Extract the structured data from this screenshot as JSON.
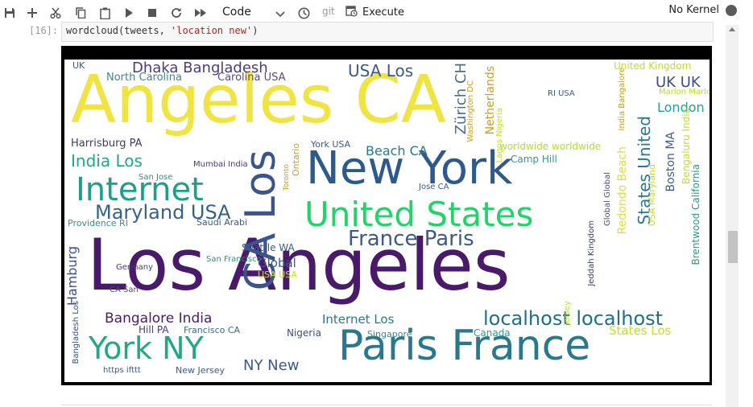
{
  "toolbar": {
    "cell_type": "Code",
    "git_label": "git",
    "execute_label": "Execute",
    "kernel_label": "No Kernel",
    "icons": [
      "save-icon",
      "add-icon",
      "cut-icon",
      "copy-icon",
      "paste-icon",
      "run-icon",
      "stop-icon",
      "restart-icon",
      "run-all-icon",
      "clock-icon",
      "chevron-down-icon",
      "execute-icon"
    ]
  },
  "cell": {
    "prompt": "[16]:",
    "code_fn": "wordcloud(tweets, ",
    "code_str": "'location new'",
    "code_end": ")"
  },
  "wordcloud": {
    "words": [
      {
        "text": "Angeles CA",
        "color": "#f0e442"
      },
      {
        "text": "Los Angeles",
        "color": "#4a1a6a"
      },
      {
        "text": "New York",
        "color": "#2d5a8a"
      },
      {
        "text": "United States",
        "color": "#22d36a"
      },
      {
        "text": "Internet",
        "color": "#1f9e89"
      },
      {
        "text": "Maryland USA",
        "color": "#35628a"
      },
      {
        "text": "France Paris",
        "color": "#3b5a8a"
      },
      {
        "text": "Paris France",
        "color": "#2a788e"
      },
      {
        "text": "York NY",
        "color": "#22a884"
      },
      {
        "text": "CA Los",
        "color": "#39558c"
      },
      {
        "text": "localhost localhost",
        "color": "#1f6f8a"
      },
      {
        "text": "Dhaka Bangladesh",
        "color": "#4c3a7a"
      },
      {
        "text": "USA Los",
        "color": "#3b5a8a"
      },
      {
        "text": "Zürich CH",
        "color": "#4a6c8e"
      },
      {
        "text": "UK UK",
        "color": "#3b4f8a"
      },
      {
        "text": "London",
        "color": "#2a9d8f"
      },
      {
        "text": "North Carolina",
        "color": "#3b8a8a"
      },
      {
        "text": "Carolina USA",
        "color": "#5a4a8a"
      },
      {
        "text": "Harrisburg PA",
        "color": "#3b3b6b"
      },
      {
        "text": "India Los",
        "color": "#22a884"
      },
      {
        "text": "Beach CA",
        "color": "#2a788e"
      },
      {
        "text": "York USA",
        "color": "#3b5a8a"
      },
      {
        "text": "worldwide worldwide",
        "color": "#b5de2b"
      },
      {
        "text": "Camp Hill",
        "color": "#2a9d8f"
      },
      {
        "text": "Redondo Beach",
        "color": "#e0dd40"
      },
      {
        "text": "States United",
        "color": "#2a788e"
      },
      {
        "text": "Boston MA",
        "color": "#3b5a8a"
      },
      {
        "text": "Bengaluru India",
        "color": "#c5e021"
      },
      {
        "text": "Brentwood California",
        "color": "#1f9e89"
      },
      {
        "text": "Hamburg",
        "color": "#3b4f8a"
      },
      {
        "text": "Global",
        "color": "#3b5a8a"
      },
      {
        "text": "Bangalore India",
        "color": "#4a1a6a"
      },
      {
        "text": "Internet Los",
        "color": "#2a788e"
      },
      {
        "text": "Nigeria",
        "color": "#3b4f8a"
      },
      {
        "text": "Canada",
        "color": "#2a9d8f"
      },
      {
        "text": "States Los",
        "color": "#c5e021"
      },
      {
        "text": "NY New",
        "color": "#3b5a8a"
      },
      {
        "text": "Seattle WA",
        "color": "#3b5a8a"
      },
      {
        "text": "Ontario",
        "color": "#c5a021"
      },
      {
        "text": "Toronto",
        "color": "#c5a021"
      },
      {
        "text": "Hill PA",
        "color": "#4a3a7a"
      },
      {
        "text": "Francisco CA",
        "color": "#3b6a8a"
      },
      {
        "text": "New Jersey",
        "color": "#3b5a8a"
      },
      {
        "text": "https ifttt",
        "color": "#3b5a8a"
      },
      {
        "text": "San Jose",
        "color": "#3b8a8a"
      },
      {
        "text": "Saudi Arabi",
        "color": "#3b5a8a"
      },
      {
        "text": "Mumbai India",
        "color": "#4a3a7a"
      },
      {
        "text": "Jersey",
        "color": "#c5e021"
      },
      {
        "text": "Washington DC",
        "color": "#c5a021"
      },
      {
        "text": "Netherlands",
        "color": "#c5a021"
      },
      {
        "text": "India Bangalore",
        "color": "#c5a021"
      },
      {
        "text": "Marlon Marlon",
        "color": "#b5de2b"
      },
      {
        "text": "United Kingdom",
        "color": "#c5e021"
      },
      {
        "text": "Singapore",
        "color": "#3b8a8a"
      },
      {
        "text": "Providence RI",
        "color": "#3b8a8a"
      },
      {
        "text": "USA USA",
        "color": "#c5e021"
      },
      {
        "text": "USA Maryland",
        "color": "#c5e021"
      },
      {
        "text": "Jeddah Kingdom",
        "color": "#3b3b6b"
      },
      {
        "text": "Global Global",
        "color": "#4a4a7a"
      },
      {
        "text": "Bangladesh Los",
        "color": "#3b4f8a"
      },
      {
        "text": "San Francisco",
        "color": "#3b8a8a"
      },
      {
        "text": "Germany",
        "color": "#4a3a7a"
      },
      {
        "text": "CA San",
        "color": "#4a4a7a"
      },
      {
        "text": "Lagos Nigeria",
        "color": "#c5e021"
      },
      {
        "text": "RI USA",
        "color": "#3b5a8a"
      },
      {
        "text": "Jose CA",
        "color": "#3b5a8a"
      },
      {
        "text": "UK",
        "color": "#3b5a8a"
      }
    ]
  }
}
